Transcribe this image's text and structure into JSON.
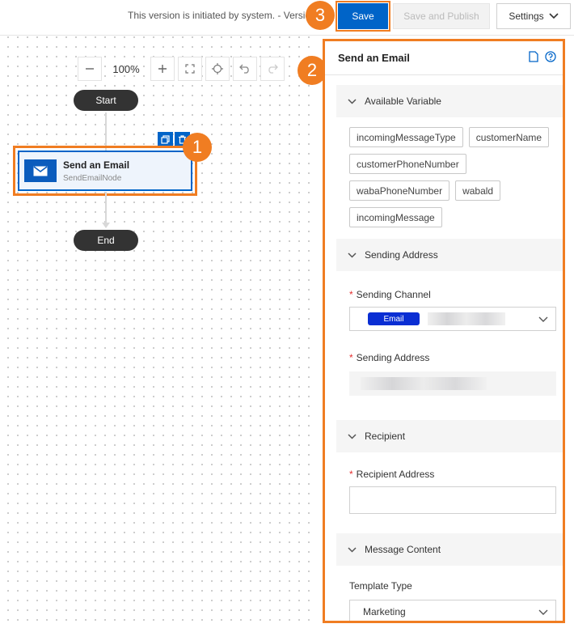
{
  "header": {
    "version_note": "This version is initiated by system. - Version",
    "save_label": "Save",
    "save_publish_label": "Save and Publish",
    "settings_label": "Settings"
  },
  "canvas": {
    "zoom_level": "100%",
    "start_label": "Start",
    "end_label": "End",
    "node": {
      "title": "Send an Email",
      "subtitle": "SendEmailNode"
    }
  },
  "callouts": [
    "1",
    "2",
    "3"
  ],
  "panel": {
    "title": "Send an Email",
    "available_variable": {
      "heading": "Available Variable",
      "variables": [
        "incomingMessageType",
        "customerName",
        "customerPhoneNumber",
        "wabaPhoneNumber",
        "wabald",
        "incomingMessage"
      ]
    },
    "sending_address": {
      "heading": "Sending Address",
      "channel_label": "Sending Channel",
      "channel_chip": "Email",
      "address_label": "Sending Address"
    },
    "recipient": {
      "heading": "Recipient",
      "address_label": "Recipient Address"
    },
    "message_content": {
      "heading": "Message Content",
      "template_type_label": "Template Type",
      "template_type_value": "Marketing"
    }
  },
  "colors": {
    "accent": "#0064c8",
    "callout": "#f07d22",
    "chip": "#0a2ed3"
  }
}
